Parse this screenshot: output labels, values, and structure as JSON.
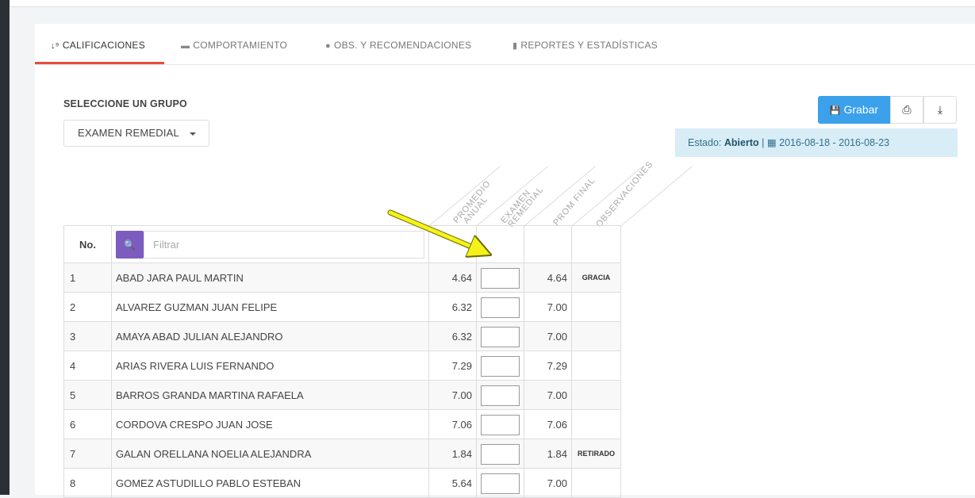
{
  "tabs": [
    {
      "icon": "sort-numeric-icon",
      "glyph": "↓⁹",
      "label": "CALIFICACIONES",
      "active": true
    },
    {
      "icon": "comment-icon",
      "glyph": "▬",
      "label": "COMPORTAMIENTO",
      "active": false
    },
    {
      "icon": "comments-icon",
      "glyph": "●",
      "label": "OBS. Y RECOMENDACIONES",
      "active": false
    },
    {
      "icon": "bar-chart-icon",
      "glyph": "▮",
      "label": "REPORTES Y ESTADÍSTICAS",
      "active": false
    }
  ],
  "group": {
    "label": "SELECCIONE UN GRUPO",
    "selected": "EXAMEN REMEDIAL"
  },
  "toolbar": {
    "save_label": "Grabar",
    "save_icon": "💾",
    "print_icon": "⎙",
    "download_icon": "⤓"
  },
  "status": {
    "prefix": "Estado: ",
    "state": "Abierto",
    "separator": " | ",
    "calendar_icon": "▦",
    "dates": "2016-08-18 - 2016-08-23"
  },
  "table": {
    "no_header": "No.",
    "filter_placeholder": "Filtrar",
    "search_icon": "🔍",
    "columns": [
      "PROMEDIO ANUAL",
      "EXAMEN REMEDIAL",
      "PROM FINAL",
      "OBSERVACIONES"
    ],
    "col_lines": [
      [
        "PROMEDIO",
        "ANUAL"
      ],
      [
        "EXAMEN",
        "REMEDIAL"
      ],
      [
        "PROM FINAL"
      ],
      [
        "OBSERVACIONES"
      ]
    ],
    "rows": [
      {
        "no": "1",
        "name": "ABAD JARA PAUL MARTIN",
        "promedio": "4.64",
        "examen": "",
        "final": "4.64",
        "obs": "GRACIA"
      },
      {
        "no": "2",
        "name": "ALVAREZ GUZMAN JUAN FELIPE",
        "promedio": "6.32",
        "examen": "",
        "final": "7.00",
        "obs": ""
      },
      {
        "no": "3",
        "name": "AMAYA ABAD JULIAN ALEJANDRO",
        "promedio": "6.32",
        "examen": "",
        "final": "7.00",
        "obs": ""
      },
      {
        "no": "4",
        "name": "ARIAS RIVERA LUIS FERNANDO",
        "promedio": "7.29",
        "examen": "",
        "final": "7.29",
        "obs": ""
      },
      {
        "no": "5",
        "name": "BARROS GRANDA MARTINA RAFAELA",
        "promedio": "7.00",
        "examen": "",
        "final": "7.00",
        "obs": ""
      },
      {
        "no": "6",
        "name": "CORDOVA CRESPO JUAN JOSE",
        "promedio": "7.06",
        "examen": "",
        "final": "7.06",
        "obs": ""
      },
      {
        "no": "7",
        "name": "GALAN ORELLANA NOELIA ALEJANDRA",
        "promedio": "1.84",
        "examen": "",
        "final": "1.84",
        "obs": "RETIRADO"
      },
      {
        "no": "8",
        "name": "GOMEZ ASTUDILLO PABLO ESTEBAN",
        "promedio": "5.64",
        "examen": "",
        "final": "7.00",
        "obs": ""
      }
    ]
  },
  "colors": {
    "accent": "#3aa1ea",
    "tab_underline": "#e74c3c",
    "search": "#7c5cbf",
    "arrow": "#f4f21a"
  }
}
